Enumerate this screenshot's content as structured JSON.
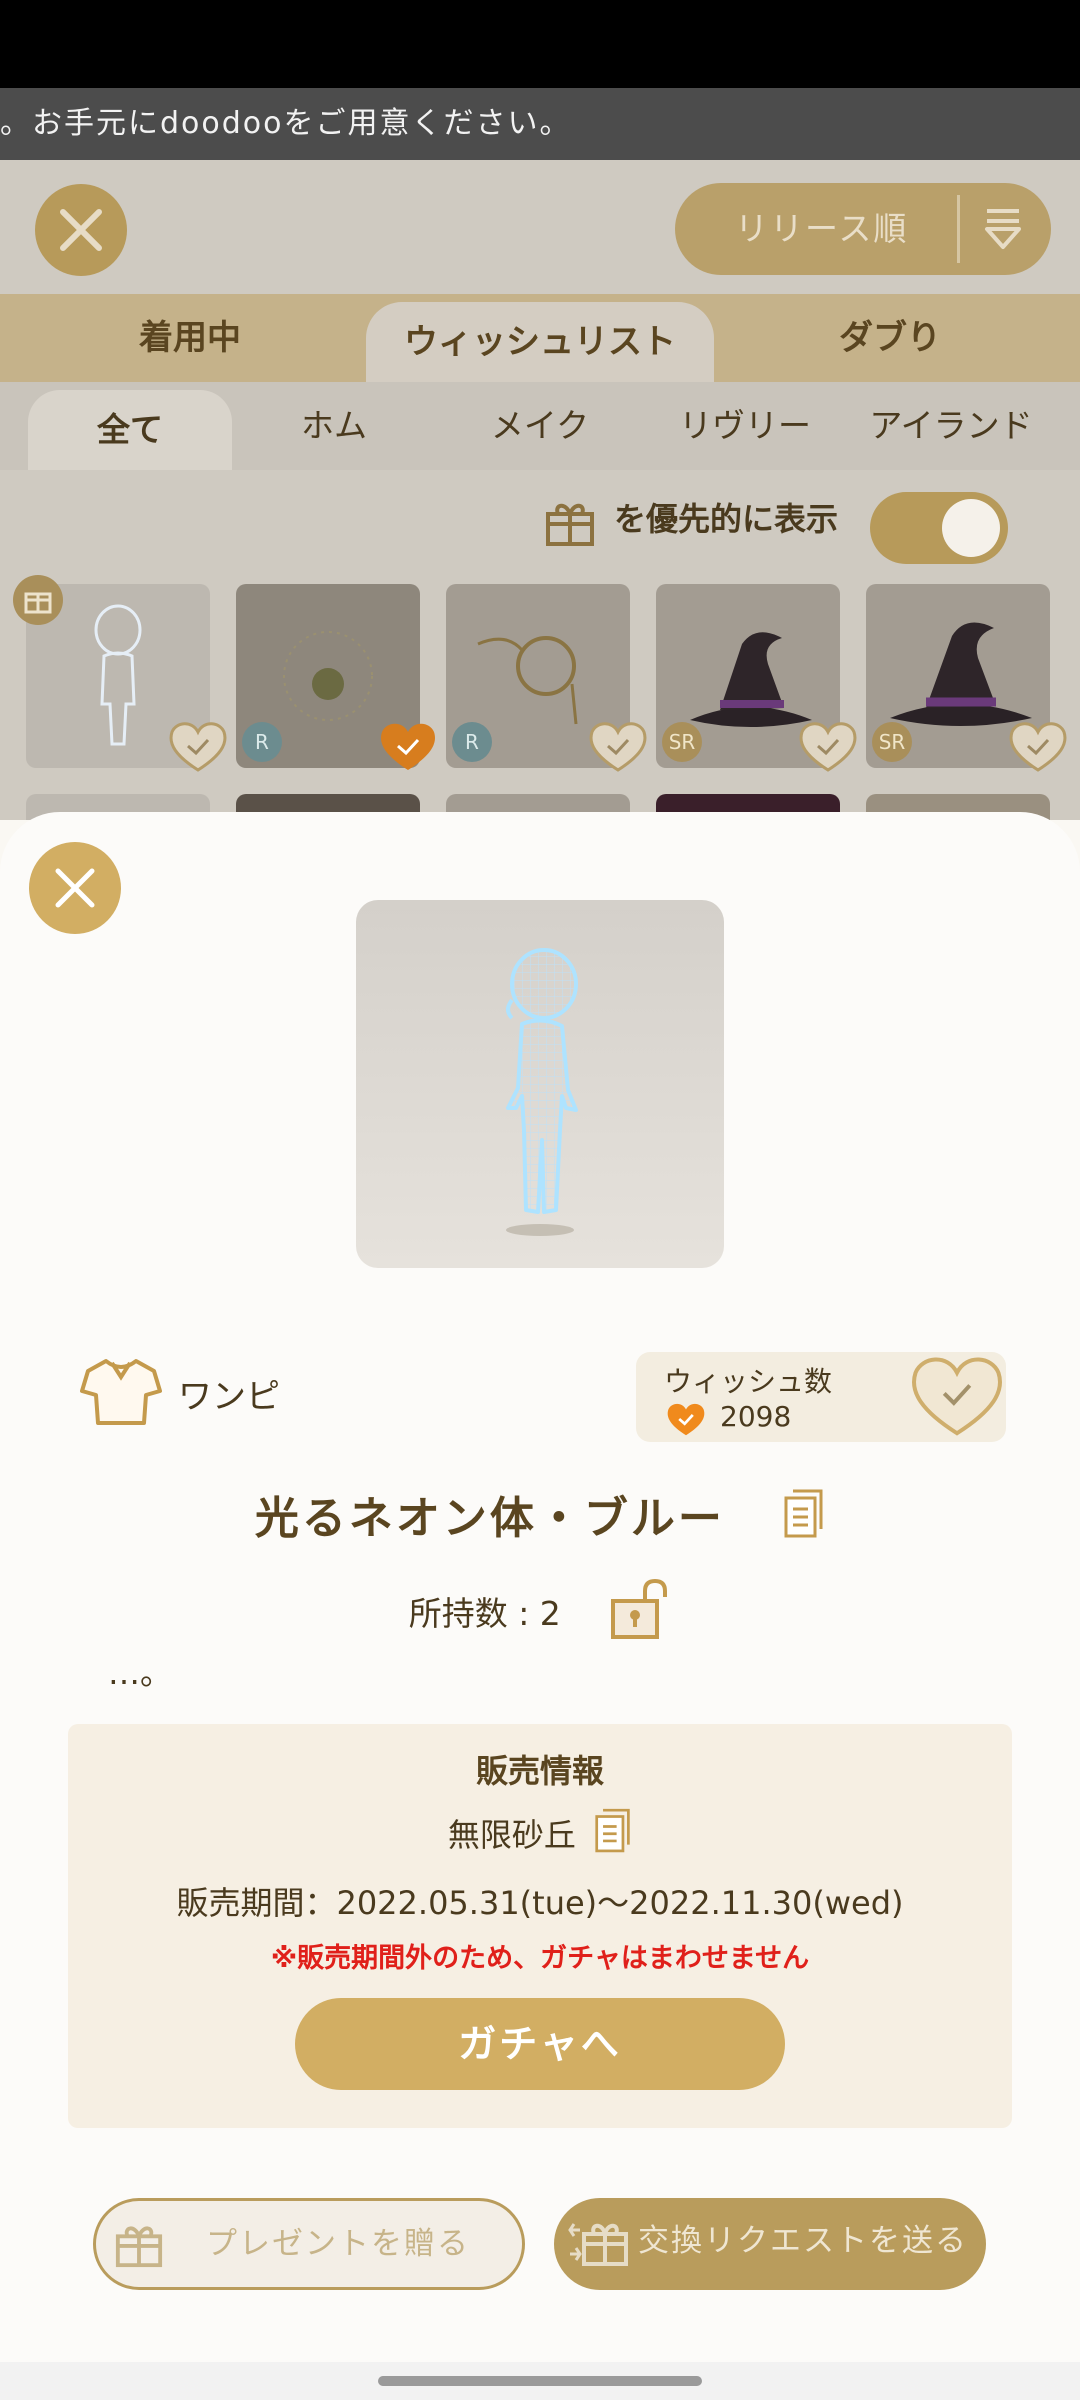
{
  "ticker": {
    "text": "。お手元にdoodooをご用意ください。"
  },
  "background": {
    "sort_label": "リリース順",
    "main_tabs": [
      "着用中",
      "ウィッシュリスト",
      "ダブり"
    ],
    "sub_tabs": [
      "全て",
      "ホム",
      "メイク",
      "リヴリー",
      "アイランド"
    ],
    "priority_label": "を優先的に表示",
    "rarity_badges": [
      "R",
      "R",
      "SR",
      "SR"
    ]
  },
  "modal": {
    "category": "ワンピ",
    "wish": {
      "title": "ウィッシュ数",
      "count": "2098"
    },
    "item_name": "光るネオン体・ブルー",
    "owned": "所持数 : 2",
    "description": "…。",
    "sale": {
      "heading": "販売情報",
      "gacha_name": "無限砂丘",
      "period": "販売期間：2022.05.31(tue)〜2022.11.30(wed)",
      "notice": "※販売期間外のため、ガチャはまわせません",
      "button": "ガチャへ"
    },
    "present_button": "プレゼントを贈る",
    "exchange_button": "交換リクエストを送る"
  },
  "colors": {
    "accent": "#d2ae63",
    "notice": "#e0201a",
    "heart": "#f08a1c"
  },
  "icons": [
    "close-icon",
    "sort-icon",
    "gift-icon",
    "shirt-icon",
    "heart-icon",
    "copy-icon",
    "lock-icon"
  ]
}
